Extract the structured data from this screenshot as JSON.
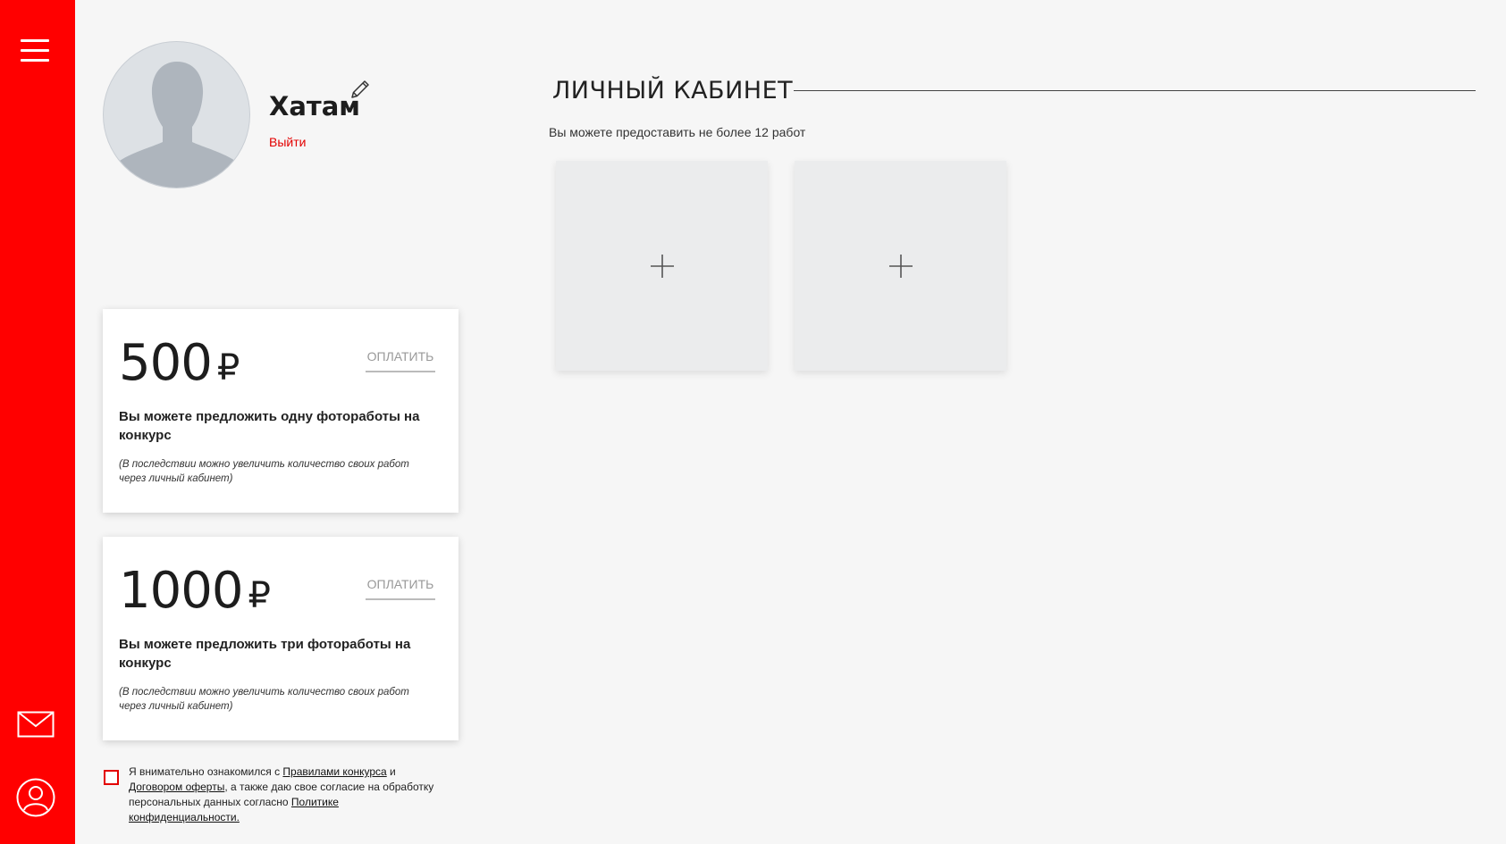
{
  "profile": {
    "name": "Хатам",
    "logout_label": "Выйти"
  },
  "section": {
    "title": "ЛИЧНЫЙ КАБИНЕТ",
    "note": "Вы можете предоставить не более 12 работ"
  },
  "cards": [
    {
      "amount": "500",
      "currency": "₽",
      "pay_label": "ОПЛАТИТЬ",
      "description": "Вы можете предложить одну фоторaботы на конкурс",
      "note": "(В последствии можно увеличить количество своих работ через личный кабинет)"
    },
    {
      "amount": "1000",
      "currency": "₽",
      "pay_label": "ОПЛАТИТЬ",
      "description": "Вы можете предложить три фоторaботы на конкурс",
      "note": "(В последствии можно увеличить количество своих работ через личный кабинет)"
    }
  ],
  "agreement": {
    "text_1": "Я внимательно ознакомился с ",
    "rules_link": "Правилами конкурса",
    "text_2": " и ",
    "offer_link": "Договором оферты",
    "text_3": ", а также даю свое согласие на обработку персональных данных согласно ",
    "privacy_link": "Политике конфиденциальности."
  },
  "icons": {
    "menu": "hamburger-menu-icon",
    "mail": "mail-icon",
    "user": "user-icon",
    "edit": "pencil-icon",
    "add": "plus-icon"
  },
  "colors": {
    "sidebar": "#ff0000",
    "accent": "#e30000",
    "background": "#f6f6f6"
  }
}
